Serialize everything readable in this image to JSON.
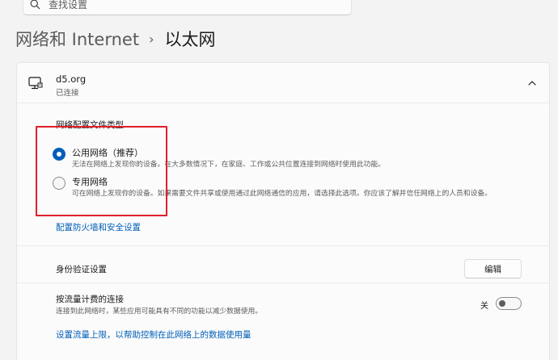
{
  "search": {
    "placeholder": "查找设置",
    "icon": "search-icon"
  },
  "breadcrumb": {
    "parent": "网络和 Internet",
    "separator": "›",
    "current": "以太网"
  },
  "connection": {
    "name": "d5.org",
    "status": "已连接",
    "icon": "monitor-network-icon"
  },
  "profile": {
    "title": "网络配置文件类型",
    "options": [
      {
        "label": "公用网络（推荐）",
        "description": "无法在网络上发现你的设备。在大多数情况下，在家庭、工作或公共位置连接到网络时使用此功能。",
        "selected": true
      },
      {
        "label": "专用网络",
        "description": "可在网络上发现你的设备。如果需要文件共享或使用通过此网络通信的应用，请选择此选项。你应该了解并信任网络上的人员和设备。",
        "selected": false
      }
    ],
    "firewall_link": "配置防火墙和安全设置"
  },
  "auth": {
    "label": "身份验证设置",
    "button": "编辑"
  },
  "metered": {
    "label": "按流量计费的连接",
    "description": "连接到此网络时，某些应用可能具有不同的功能以减少数据使用。",
    "state_label": "关",
    "on": false,
    "data_limit_link": "设置流量上限，以帮助控制在此网络上的数据使用量"
  },
  "colors": {
    "accent": "#005fb8",
    "highlight": "#e0202a"
  }
}
